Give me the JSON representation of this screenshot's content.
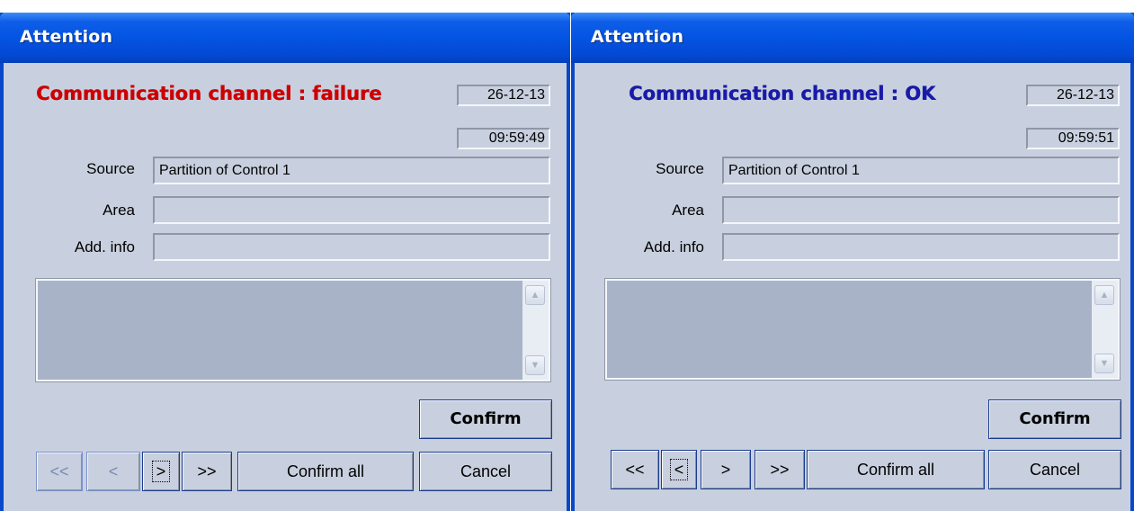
{
  "dialogs": [
    {
      "title": "Attention",
      "headline": "Communication channel : failure",
      "headline_color": "#cc0000",
      "date": "26-12-13",
      "time": "09:59:49",
      "source_label": "Source",
      "source_value": "Partition of Control 1",
      "area_label": "Area",
      "area_value": "",
      "addinfo_label": "Add. info",
      "addinfo_value": "",
      "confirm_label": "Confirm",
      "nav": {
        "first": "<<",
        "prev": "<",
        "next": ">",
        "last": ">>",
        "focused": "next",
        "disabled": [
          "first",
          "prev"
        ]
      },
      "confirm_all_label": "Confirm all",
      "cancel_label": "Cancel"
    },
    {
      "title": "Attention",
      "headline": "Communication channel : OK",
      "headline_color": "#1a1aa8",
      "date": "26-12-13",
      "time": "09:59:51",
      "source_label": "Source",
      "source_value": "Partition of Control 1",
      "area_label": "Area",
      "area_value": "",
      "addinfo_label": "Add. info",
      "addinfo_value": "",
      "confirm_label": "Confirm",
      "nav": {
        "first": "<<",
        "prev": "<",
        "next": ">",
        "last": ">>",
        "focused": "prev",
        "disabled": []
      },
      "confirm_all_label": "Confirm all",
      "cancel_label": "Cancel"
    }
  ],
  "icons": {
    "scroll_up": "scroll-up-arrow-icon",
    "scroll_down": "scroll-down-arrow-icon"
  },
  "colors": {
    "titlebar": "#0454e3",
    "dialog_background": "#c8d0df",
    "memo_background": "#a9b3c8"
  }
}
